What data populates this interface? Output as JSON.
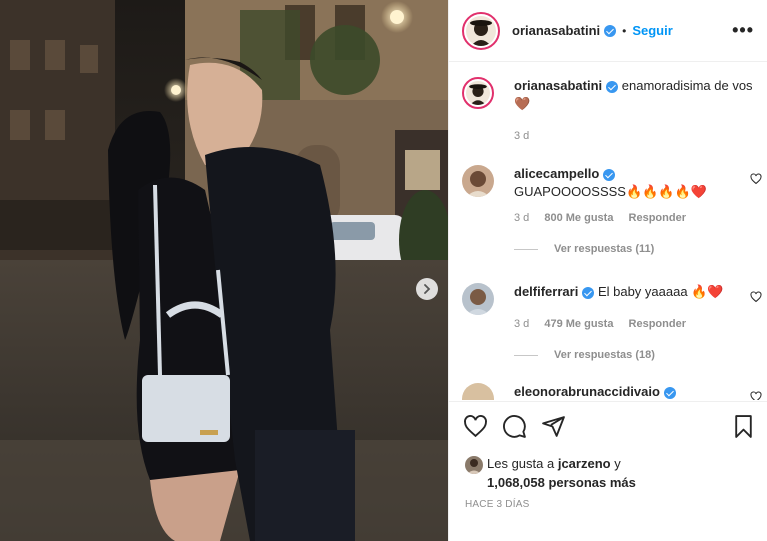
{
  "header": {
    "username": "orianasabatini",
    "separator": "•",
    "follow_label": "Seguir",
    "more_label": "•••"
  },
  "caption": {
    "username": "orianasabatini",
    "text": "enamoradisima de vos 🤎",
    "time": "3 d"
  },
  "comments": [
    {
      "username": "alicecampello",
      "text": "GUAPOOOOSSSS🔥🔥🔥🔥❤️",
      "time": "3 d",
      "likes": "800 Me gusta",
      "reply_label": "Responder",
      "view_replies": "Ver respuestas (11)"
    },
    {
      "username": "delfiferrari",
      "text": "El baby yaaaaa 🔥❤️",
      "time": "3 d",
      "likes": "479 Me gusta",
      "reply_label": "Responder",
      "view_replies": "Ver respuestas (18)"
    },
    {
      "username": "eleonorabrunaccidivaio"
    }
  ],
  "likes": {
    "prefix": "Les gusta a",
    "user": "jcarzeno",
    "conj": "y",
    "count": "1,068,058 personas más"
  },
  "timestamp": "HACE 3 DÍAS",
  "colors": {
    "accent": "#0095f6",
    "verified": "#3897f0",
    "muted": "#8e8e8e",
    "text": "#262626"
  },
  "icons": [
    "heart-icon",
    "comment-icon",
    "share-icon",
    "bookmark-icon",
    "chevron-right-icon",
    "verified-icon",
    "more-icon"
  ]
}
